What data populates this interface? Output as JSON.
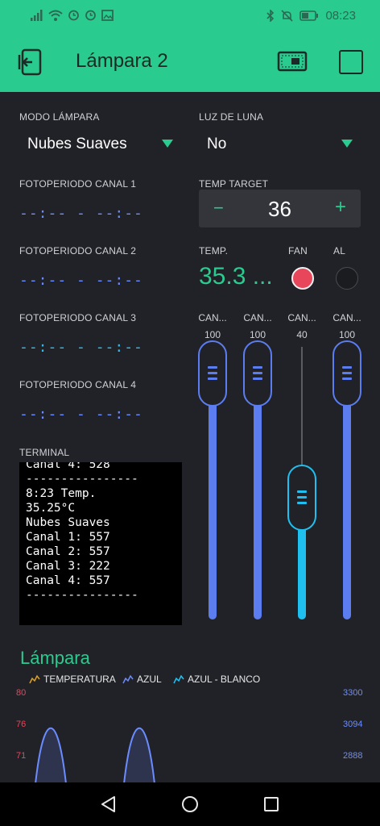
{
  "status_bar": {
    "time": "08:23",
    "icons": [
      "signal-icon",
      "wifi-icon",
      "alarm-icon",
      "alarm-icon",
      "image-icon",
      "bluetooth-icon",
      "mute-icon",
      "battery-icon"
    ]
  },
  "app_bar": {
    "title": "Lámpara 2"
  },
  "modo_lampara": {
    "label": "MODO LÁMPARA",
    "value": "Nubes Suaves"
  },
  "luz_de_luna": {
    "label": "LUZ DE LUNA",
    "value": "No"
  },
  "fotoperiodos": [
    {
      "label": "FOTOPERIODO CANAL 1",
      "value": "--:-- - --:--",
      "color": "#6b8cff"
    },
    {
      "label": "FOTOPERIODO CANAL 2",
      "value": "--:-- - --:--",
      "color": "#6b8cff"
    },
    {
      "label": "FOTOPERIODO CANAL 3",
      "value": "--:-- - --:--",
      "color": "#21c3f5"
    },
    {
      "label": "FOTOPERIODO CANAL 4",
      "value": "--:-- - --:--",
      "color": "#6b8cff"
    }
  ],
  "temp_target": {
    "label": "TEMP TARGET",
    "value": "36",
    "minus": "−",
    "plus": "+"
  },
  "temp": {
    "label": "TEMP.",
    "value": "35.3 ..."
  },
  "fan": {
    "label": "FAN",
    "on": true,
    "color": "#e8465a"
  },
  "al": {
    "label": "AL",
    "on": false
  },
  "terminal": {
    "label": "TERMINAL",
    "text": "Canal 4: 528\n----------------\n8:23 Temp.\n35.25°C\nNubes Suaves\nCanal 1: 557\nCanal 2: 557\nCanal 3: 222\nCanal 4: 557\n----------------"
  },
  "sliders": [
    {
      "label": "CAN...",
      "value": "100",
      "level": 1.0,
      "color": "#5b7df0"
    },
    {
      "label": "CAN...",
      "value": "100",
      "level": 1.0,
      "color": "#5b7df0"
    },
    {
      "label": "CAN...",
      "value": "40",
      "level": 0.4,
      "color": "#1fc0f0"
    },
    {
      "label": "CAN...",
      "value": "100",
      "level": 1.0,
      "color": "#5b7df0"
    }
  ],
  "chart": {
    "title": "Lámpara",
    "legend": [
      {
        "name": "TEMPERATURA",
        "color": "#e0a020"
      },
      {
        "name": "AZUL",
        "color": "#6b8cff"
      },
      {
        "name": "AZUL - BLANCO",
        "color": "#21c3f5"
      }
    ],
    "left_ticks": [
      "80",
      "76",
      "71"
    ],
    "right_ticks": [
      "3300",
      "3094",
      "2888"
    ]
  },
  "chart_data": {
    "type": "line",
    "title": "Lámpara",
    "series": [
      {
        "name": "TEMPERATURA",
        "values": []
      },
      {
        "name": "AZUL",
        "values": [
          2400,
          3170,
          2400,
          2400,
          3170,
          2400
        ]
      },
      {
        "name": "AZUL - BLANCO",
        "values": []
      }
    ],
    "y_left_ticks": [
      80,
      76,
      71
    ],
    "y_right_ticks": [
      3300,
      3094,
      2888
    ],
    "y_right_range": [
      2700,
      3300
    ]
  },
  "nav": {
    "back": "back-icon",
    "home": "home-icon",
    "recents": "recents-icon"
  }
}
